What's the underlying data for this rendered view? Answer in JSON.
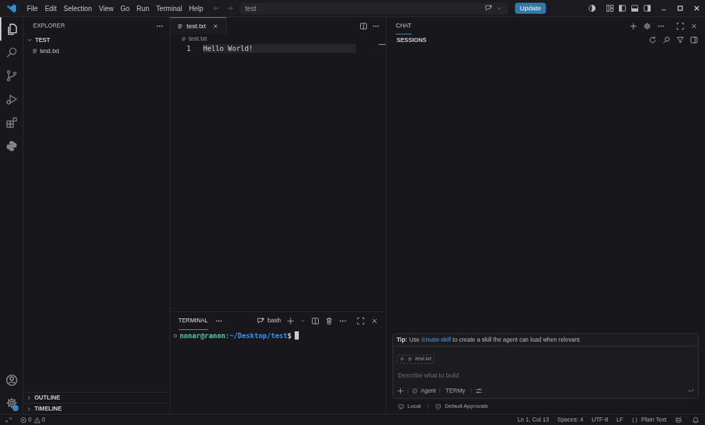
{
  "menu": [
    "File",
    "Edit",
    "Selection",
    "View",
    "Go",
    "Run",
    "Terminal",
    "Help"
  ],
  "command_center": {
    "value": "test"
  },
  "update_button": "Update",
  "activity_bar": [
    {
      "kind": "files",
      "selected": true
    },
    {
      "kind": "search",
      "selected": false
    },
    {
      "kind": "source-control",
      "selected": false
    },
    {
      "kind": "run",
      "selected": false
    },
    {
      "kind": "extensions",
      "selected": false
    },
    {
      "kind": "python",
      "selected": false
    }
  ],
  "sidebar": {
    "title": "EXPLORER",
    "tree": [
      {
        "label": "TEST",
        "expanded": true,
        "children": [
          {
            "label": "test.txt"
          }
        ]
      }
    ],
    "sections": [
      {
        "label": "OUTLINE",
        "expanded": false
      },
      {
        "label": "TIMELINE",
        "expanded": false
      }
    ]
  },
  "editor": {
    "tabs": [
      {
        "label": "test.txt",
        "selected": true
      }
    ],
    "breadcrumb": "test.txt",
    "lines": [
      {
        "number": "1",
        "text": "Hello World!"
      }
    ]
  },
  "panel": {
    "tabs": [
      {
        "label": "TERMINAL",
        "selected": true
      }
    ],
    "shell": "bash",
    "prompt": {
      "user": "nonar@ranon",
      "path": ":~/Desktop/test",
      "symbol": "$"
    }
  },
  "chat": {
    "tab": "CHAT",
    "sessions_title": "SESSIONS",
    "tip": {
      "label": "Tip:",
      "before": "Use",
      "link": "/create-skill",
      "after": "to create a skill the agent can load when relevant."
    },
    "attachment": "test.txt",
    "placeholder": "Describe what to build",
    "mode": "Agent",
    "model": "TERMy",
    "footer": [
      "Local",
      "Default Approvals"
    ]
  },
  "status_bar": {
    "errors": "0",
    "warnings": "0",
    "items": [
      "Ln 1, Col 13",
      "Spaces: 4",
      "UTF-8",
      "LF",
      "Plain Text"
    ]
  }
}
